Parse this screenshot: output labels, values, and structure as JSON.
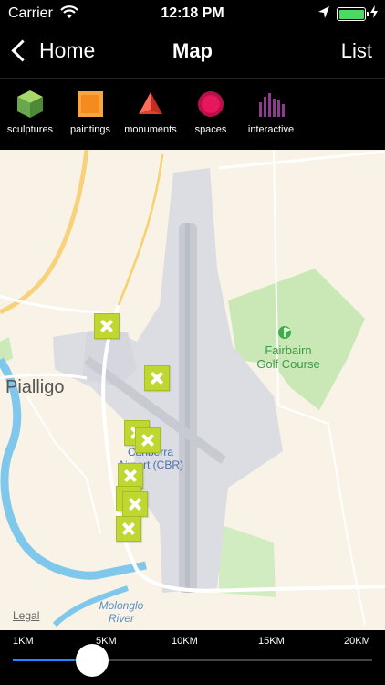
{
  "status": {
    "carrier": "Carrier",
    "time": "12:18 PM"
  },
  "nav": {
    "back_label": "Home",
    "title": "Map",
    "right_label": "List"
  },
  "categories": [
    {
      "label": "sculptures",
      "icon": "cube-icon",
      "color": "#7bc043"
    },
    {
      "label": "paintings",
      "icon": "square-icon",
      "color": "#f58a1f"
    },
    {
      "label": "monuments",
      "icon": "pyramid-icon",
      "color": "#e63b2e"
    },
    {
      "label": "spaces",
      "icon": "circle-icon",
      "color": "#e6175c"
    },
    {
      "label": "interactive",
      "icon": "equalizer-icon",
      "color": "#8e3a8e"
    }
  ],
  "map": {
    "labels": {
      "suburb": "Pialligo",
      "golf_line1": "Fairbairn",
      "golf_line2": "Golf Course",
      "airport_line1": "Canberra",
      "airport_line2": "Airport (CBR)",
      "river_line1": "Molonglo",
      "river_line2": "River",
      "legal": "Legal"
    },
    "marker_count": 8
  },
  "distance": {
    "ticks": [
      "1KM",
      "5KM",
      "10KM",
      "15KM",
      "20KM"
    ],
    "value_km": 5,
    "accent": "#1a8cff"
  }
}
